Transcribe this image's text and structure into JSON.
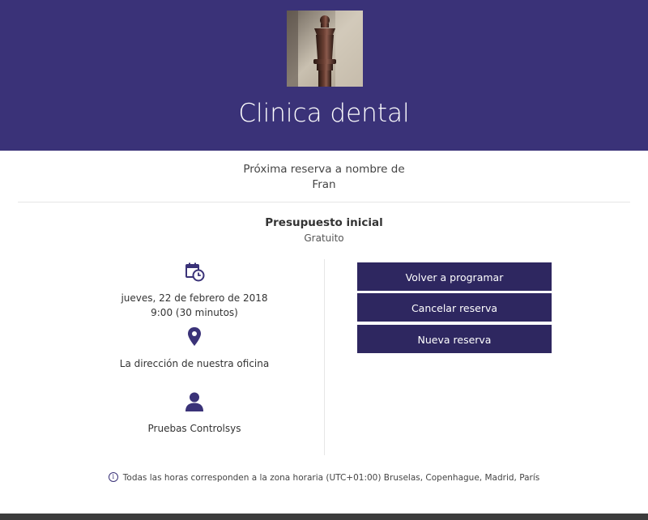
{
  "header": {
    "title": "Clinica dental",
    "logo_icon": "chess-piece-photo",
    "background": "#3a3278"
  },
  "booking": {
    "subtitle_line1": "Próxima reserva a nombre de",
    "subtitle_line2": "Fran"
  },
  "service": {
    "name": "Presupuesto inicial",
    "price": "Gratuito"
  },
  "details": {
    "date_icon": "calendar-clock-icon",
    "date": "jueves, 22 de febrero de 2018",
    "time": "9:00 (30 minutos)",
    "location_icon": "map-pin-icon",
    "location": "La dirección de nuestra oficina",
    "staff_icon": "person-icon",
    "staff": "Pruebas Controlsys"
  },
  "actions": {
    "reschedule": "Volver a programar",
    "cancel": "Cancelar reserva",
    "new": "Nueva reserva",
    "button_color": "#2e2760"
  },
  "footer": {
    "info_icon": "info-icon",
    "timezone_note": "Todas las horas corresponden a la zona horaria (UTC+01:00) Bruselas, Copenhague, Madrid, París"
  }
}
